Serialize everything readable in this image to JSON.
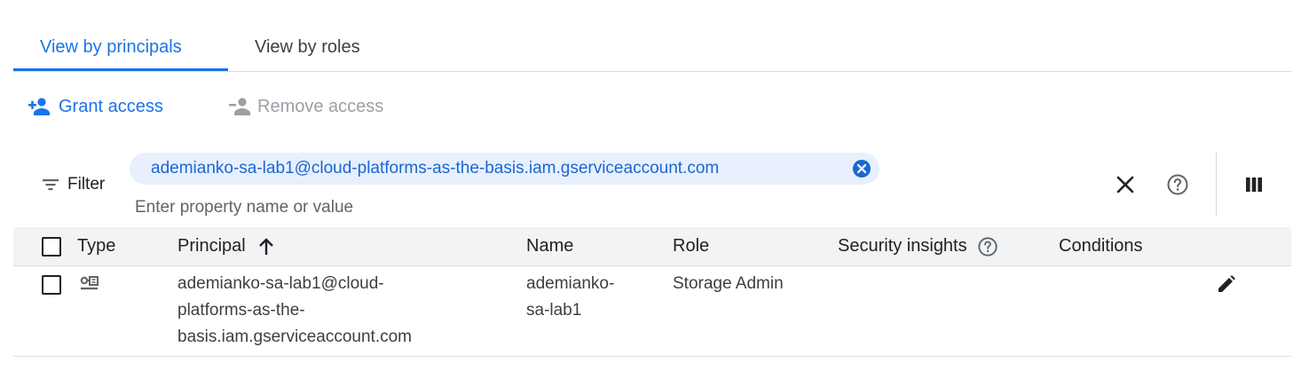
{
  "tabs": [
    {
      "label": "View by principals",
      "active": true
    },
    {
      "label": "View by roles",
      "active": false
    }
  ],
  "actions": {
    "grant_label": "Grant access",
    "remove_label": "Remove access"
  },
  "filter": {
    "label": "Filter",
    "chip_value": "ademianko-sa-lab1@cloud-platforms-as-the-basis.iam.gserviceaccount.com",
    "placeholder": "Enter property name or value"
  },
  "table": {
    "columns": [
      "Type",
      "Principal",
      "Name",
      "Role",
      "Security insights",
      "Conditions"
    ],
    "sorted_column": "Principal",
    "sort_direction": "ascending",
    "rows": [
      {
        "type_icon": "service-account-icon",
        "principal_lines": [
          "ademianko-sa-lab1@cloud-",
          "platforms-as-the-",
          "basis.iam.gserviceaccount.com"
        ],
        "name_lines": [
          "ademianko-",
          "sa-lab1"
        ],
        "role": "Storage Admin",
        "security_insights": "",
        "conditions": ""
      }
    ]
  },
  "colors": {
    "accent": "#1a73e8",
    "chip_bg": "#e8f0fe",
    "chip_text": "#1967d2",
    "disabled": "#9aa0a6",
    "header_bg": "#f1f3f4",
    "divider": "#dadce0"
  }
}
